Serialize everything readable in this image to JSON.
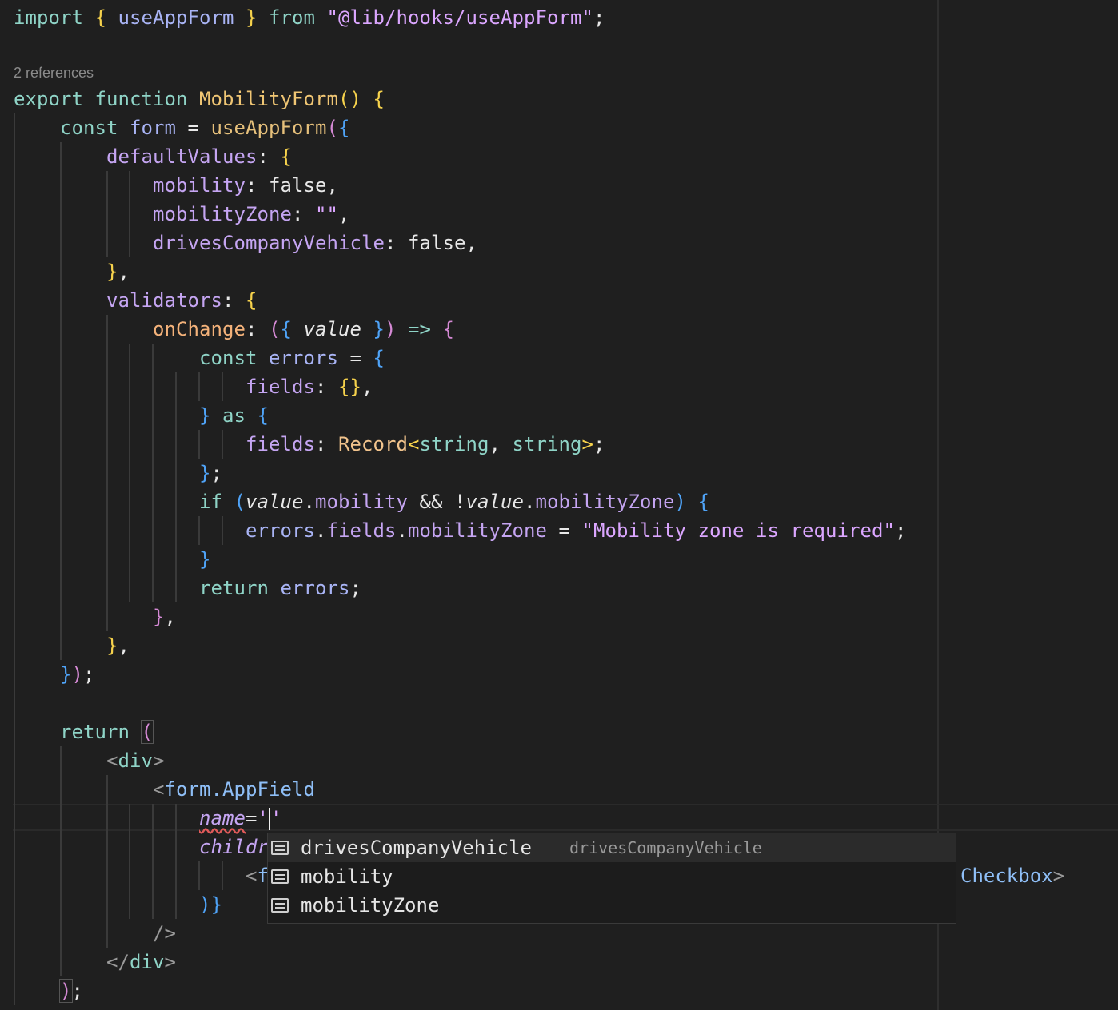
{
  "editor": {
    "codelens": "2 references",
    "lines": {
      "l1": {
        "t1": "import",
        "t2": "{",
        "t3": "useAppForm",
        "t4": "}",
        "t5": "from",
        "t6": "\"@lib/hooks/useAppForm\"",
        "t7": ";"
      },
      "l3": {
        "t1": "export",
        "t2": "function",
        "t3": "MobilityForm",
        "t4": "()",
        "t5": "{"
      },
      "l4": {
        "t1": "const",
        "t2": "form",
        "t3": "=",
        "t4": "useAppForm",
        "t5": "(",
        "t6": "{"
      },
      "l5": {
        "t1": "defaultValues",
        "t2": ":",
        "t3": "{"
      },
      "l6": {
        "t1": "mobility",
        "t2": ":",
        "t3": "false,"
      },
      "l7": {
        "t1": "mobilityZone",
        "t2": ":",
        "t3": "\"\"",
        "t4": ","
      },
      "l8": {
        "t1": "drivesCompanyVehicle",
        "t2": ":",
        "t3": "false,"
      },
      "l9": {
        "t1": "}",
        "t2": ","
      },
      "l10": {
        "t1": "validators",
        "t2": ":",
        "t3": "{"
      },
      "l11": {
        "t1": "onChange",
        "t2": ":",
        "t3": "(",
        "t4": "{",
        "t5": "value",
        "t6": "}",
        "t7": ")",
        "t8": "=>",
        "t9": "{"
      },
      "l12": {
        "t1": "const",
        "t2": "errors",
        "t3": "=",
        "t4": "{"
      },
      "l13": {
        "t1": "fields",
        "t2": ":",
        "t3": "{}",
        "t4": ","
      },
      "l14": {
        "t1": "}",
        "t2": "as",
        "t3": "{"
      },
      "l15": {
        "t1": "fields",
        "t2": ":",
        "t3": "Record",
        "t4": "<",
        "t5": "string",
        "t6": ",",
        "t7": "string",
        "t8": ">",
        "t9": ";"
      },
      "l16": {
        "t1": "}",
        "t2": ";"
      },
      "l17": {
        "t1": "if",
        "t2": "(",
        "t3": "value",
        "t4": ".",
        "t5": "mobility",
        "t6": "&&",
        "t7": "!",
        "t8": "value",
        "t9": ".",
        "t10": "mobilityZone",
        "t11": ")",
        "t12": "{"
      },
      "l18": {
        "t1": "errors",
        "t2": ".",
        "t3": "fields",
        "t4": ".",
        "t5": "mobilityZone",
        "t6": "=",
        "t7": "\"Mobility zone is required\"",
        "t8": ";"
      },
      "l19": {
        "t1": "}"
      },
      "l20": {
        "t1": "return",
        "t2": "errors",
        "t3": ";"
      },
      "l21": {
        "t1": "}",
        "t2": ","
      },
      "l22": {
        "t1": "}",
        "t2": ","
      },
      "l23": {
        "t1": "}",
        "t2": ")",
        "t3": ";"
      },
      "l25": {
        "t1": "return",
        "t2": "("
      },
      "l26": {
        "t1": "<",
        "t2": "div",
        "t3": ">"
      },
      "l27": {
        "t1": "<",
        "t2": "form.AppField"
      },
      "l28": {
        "t1": "name",
        "t2": "=",
        "t3": "'",
        "t4": "'"
      },
      "l29": {
        "t1": "childr"
      },
      "l30": {
        "t1": "<",
        "t2": "f"
      },
      "l31": {
        "t1": ")",
        "t2": "}"
      },
      "l32": {
        "t1": "/>"
      },
      "l33": {
        "t1": "</",
        "t2": "div",
        "t3": ">"
      },
      "l34": {
        "t1": ")",
        "t2": ";"
      }
    },
    "overflow_text": {
      "t1": "Checkbox",
      "t2": ">"
    }
  },
  "suggest": {
    "items": [
      {
        "label": "drivesCompanyVehicle",
        "detail": "drivesCompanyVehicle",
        "icon": "field-icon"
      },
      {
        "label": "mobility",
        "detail": "",
        "icon": "field-icon"
      },
      {
        "label": "mobilityZone",
        "detail": "",
        "icon": "field-icon"
      }
    ]
  },
  "colors": {
    "background": "#1f1f1f",
    "keyword": "#8fd4c7",
    "function": "#f0c674",
    "property": "#c5a5f2",
    "string": "#dba6ff",
    "bracket1": "#f6d24c",
    "bracket2": "#d68ad6",
    "bracket3": "#4fa3f7"
  }
}
